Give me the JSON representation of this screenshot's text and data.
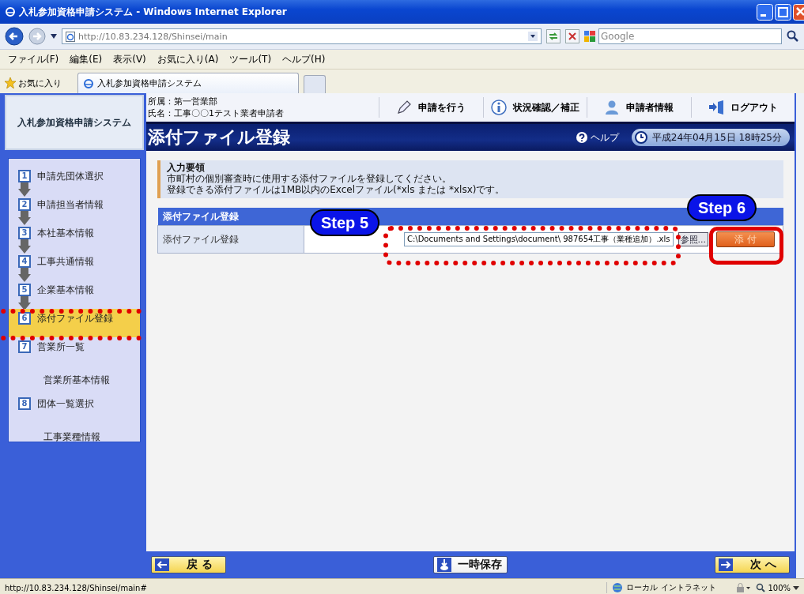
{
  "window": {
    "title": "入札参加資格申請システム - Windows Internet Explorer"
  },
  "address_bar": {
    "url": "http://10.83.234.128/Shinsei/main"
  },
  "search": {
    "placeholder": "Google"
  },
  "menu": [
    "ファイル(F)",
    "編集(E)",
    "表示(V)",
    "お気に入り(A)",
    "ツール(T)",
    "ヘルプ(H)"
  ],
  "favorites": {
    "label": "お気に入り"
  },
  "tabs": [
    {
      "label": "入札参加資格申請システム",
      "selected": true
    }
  ],
  "app": {
    "name": "入札参加資格申請システム",
    "department": "所属：第一営業部",
    "user": "氏名：工事〇〇1テスト業者申請者"
  },
  "nav": [
    {
      "kind": "pencil",
      "label": "申請を行う"
    },
    {
      "kind": "info",
      "label": "状況確認／補正"
    },
    {
      "kind": "person",
      "label": "申請者情報"
    },
    {
      "kind": "logout",
      "label": "ログアウト"
    }
  ],
  "page_title": "添付ファイル登録",
  "help": "ヘルプ",
  "datetime": "平成24年04月15日 18時25分",
  "steps": [
    {
      "kind": "step",
      "number": "1",
      "label": "申請先団体選択",
      "completed": true,
      "selected": false
    },
    {
      "kind": "step",
      "number": "2",
      "label": "申請担当者情報",
      "completed": true,
      "selected": false
    },
    {
      "kind": "step",
      "number": "3",
      "label": "本社基本情報",
      "completed": true,
      "selected": false
    },
    {
      "kind": "step",
      "number": "4",
      "label": "工事共通情報",
      "completed": true,
      "selected": false
    },
    {
      "kind": "step",
      "number": "5",
      "label": "企業基本情報",
      "completed": true,
      "selected": false
    },
    {
      "kind": "step",
      "number": "6",
      "label": "添付ファイル登録",
      "completed": false,
      "selected": true
    },
    {
      "kind": "step",
      "number": "7",
      "label": "営業所一覧",
      "completed": false,
      "selected": false
    },
    {
      "kind": "sub",
      "label": "営業所基本情報",
      "selected": false
    },
    {
      "kind": "step",
      "number": "8",
      "label": "団体一覧選択",
      "completed": false,
      "selected": false
    },
    {
      "kind": "sub",
      "label": "工事業種情報",
      "selected": false
    }
  ],
  "instructions": {
    "heading": "入力要領",
    "lines": [
      "市町村の個別審査時に使用する添付ファイルを登録してください。",
      "登録できる添付ファイルは1MB以内のExcelファイル(*xls または *xlsx)です。"
    ]
  },
  "form": {
    "header": "添付ファイル登録",
    "label": "添付ファイル登録",
    "file_value": "C:\\Documents and Settings\\document\\ 987654工事（業種追加）.xls",
    "browse": "参照...",
    "attach": "添 付"
  },
  "annotations": [
    {
      "label": "Step 5"
    },
    {
      "label": "Step 6"
    }
  ],
  "footer": {
    "back": "戻 る",
    "save": "一時保存",
    "next": "次 へ"
  },
  "status_bar": {
    "url": "http://10.83.234.128/Shinsei/main#",
    "zone": "ローカル イントラネット",
    "zoom": "100%"
  }
}
